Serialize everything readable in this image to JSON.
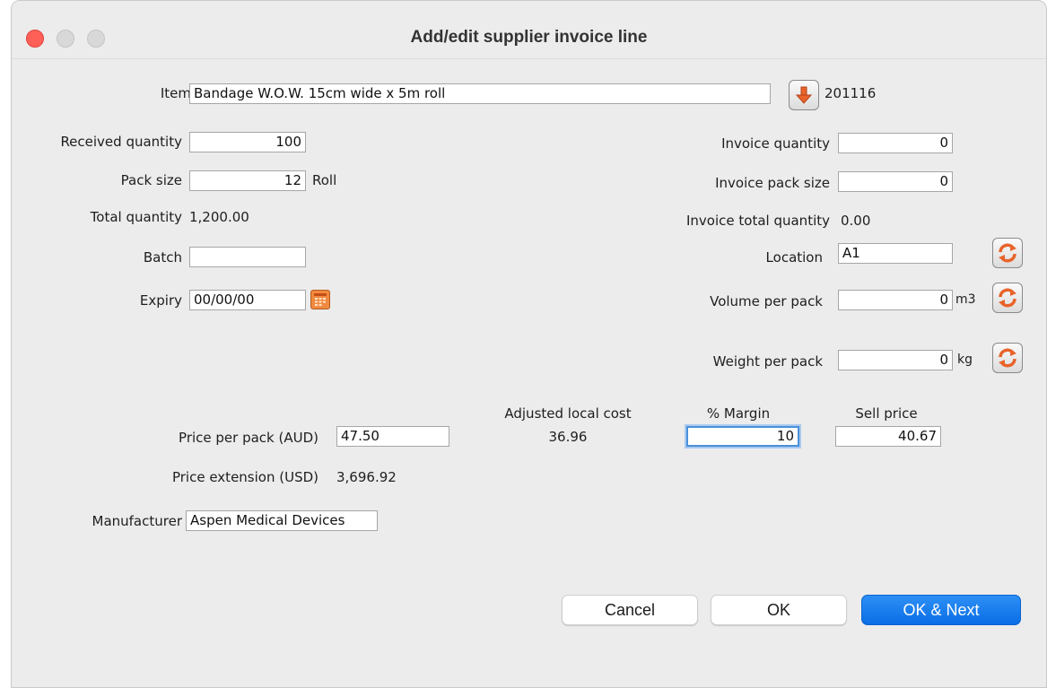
{
  "window": {
    "title": "Add/edit supplier invoice line"
  },
  "item": {
    "label": "Item",
    "value": "Bandage W.O.W. 15cm wide x 5m roll",
    "code": "201116"
  },
  "received_quantity": {
    "label": "Received quantity",
    "value": "100"
  },
  "pack_size": {
    "label": "Pack size",
    "value": "12",
    "unit": "Roll"
  },
  "total_quantity": {
    "label": "Total quantity",
    "value": "1,200.00"
  },
  "batch": {
    "label": "Batch",
    "value": ""
  },
  "expiry": {
    "label": "Expiry",
    "value": "00/00/00"
  },
  "invoice_quantity": {
    "label": "Invoice quantity",
    "value": "0"
  },
  "invoice_pack_size": {
    "label": "Invoice pack size",
    "value": "0"
  },
  "invoice_total_quantity": {
    "label": "Invoice total quantity",
    "value": "0.00"
  },
  "location": {
    "label": "Location",
    "value": "A1"
  },
  "volume_per_pack": {
    "label": "Volume per pack",
    "value": "0",
    "unit": "m3"
  },
  "weight_per_pack": {
    "label": "Weight per pack",
    "value": "0",
    "unit": "kg"
  },
  "price_per_pack": {
    "label": "Price per pack (AUD)",
    "value": "47.50"
  },
  "adjusted_local_cost": {
    "label": "Adjusted local cost",
    "value": "36.96"
  },
  "margin": {
    "label": "% Margin",
    "value": "10"
  },
  "sell_price": {
    "label": "Sell price",
    "value": "40.67"
  },
  "price_extension": {
    "label": "Price extension (USD)",
    "value": "3,696.92"
  },
  "manufacturer": {
    "label": "Manufacturer",
    "value": "Aspen Medical Devices"
  },
  "buttons": {
    "cancel": "Cancel",
    "ok": "OK",
    "ok_next": "OK & Next"
  },
  "colors": {
    "primary": "#0a6ee6",
    "close_light": "#fe5f57",
    "icon_orange": "#e8632a",
    "focus": "#4a90d9"
  }
}
